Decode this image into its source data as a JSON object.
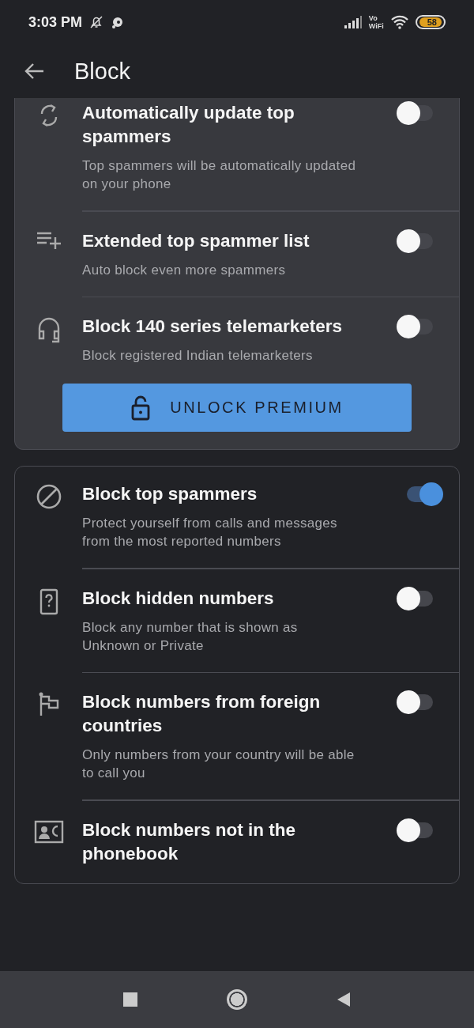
{
  "status_bar": {
    "time": "3:03 PM",
    "vowifi": [
      "Vo",
      "WiFi"
    ],
    "battery": "58"
  },
  "app_bar": {
    "title": "Block"
  },
  "premium_card": {
    "items": [
      {
        "title": "Automatically update top spammers",
        "description": "Top spammers will be automatically updated on your phone",
        "on": false
      },
      {
        "title": "Extended top spammer list",
        "description": "Auto block even more spammers",
        "on": false
      },
      {
        "title": "Block 140 series telemarketers",
        "description": "Block registered Indian telemarketers",
        "on": false
      }
    ],
    "button": "UNLOCK PREMIUM"
  },
  "block_card": {
    "items": [
      {
        "title": "Block top spammers",
        "description": "Protect yourself from calls and messages from the most reported numbers",
        "on": true
      },
      {
        "title": "Block hidden numbers",
        "description": "Block any number that is shown as Unknown or Private",
        "on": false
      },
      {
        "title": "Block numbers from foreign countries",
        "description": "Only numbers from your country will be able to call you",
        "on": false
      },
      {
        "title": "Block numbers not in the phonebook",
        "on": false
      }
    ]
  }
}
